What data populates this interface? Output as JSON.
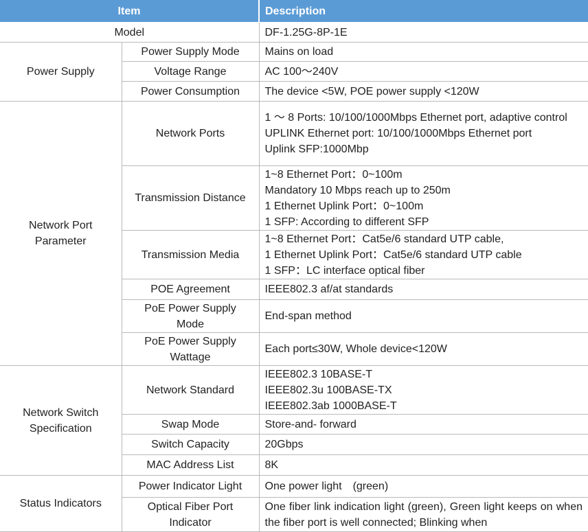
{
  "header": {
    "item": "Item",
    "description": "Description"
  },
  "model": {
    "label": "Model",
    "value": "DF-1.25G-8P-1E"
  },
  "power_supply": {
    "category": "Power Supply",
    "mode": {
      "label": "Power Supply Mode",
      "value": "Mains on load"
    },
    "voltage": {
      "label": "Voltage Range",
      "value": "AC 100～240V"
    },
    "consumption": {
      "label": "Power Consumption",
      "value": "The device <5W, POE power supply <120W"
    }
  },
  "network_port": {
    "category_line1": "Network Port",
    "category_line2": "Parameter",
    "ports": {
      "label": "Network Ports",
      "lines": [
        "1 ～ 8 Ports: 10/100/1000Mbps Ethernet port, adaptive control",
        "UPLINK Ethernet port: 10/100/1000Mbps Ethernet port",
        "Uplink SFP:1000Mbp"
      ]
    },
    "distance": {
      "label": "Transmission Distance",
      "lines": [
        "1~8 Ethernet Port：0~100m",
        "Mandatory 10 Mbps reach up to 250m",
        "1 Ethernet Uplink Port：0~100m",
        "1 SFP: According to different SFP"
      ]
    },
    "media": {
      "label": "Transmission Media",
      "lines": [
        "1~8 Ethernet Port：Cat5e/6 standard UTP cable,",
        "1 Ethernet Uplink Port：Cat5e/6 standard UTP cable",
        "1 SFP：LC interface optical fiber"
      ]
    },
    "poe_agreement": {
      "label": "POE Agreement",
      "value": "IEEE802.3 af/at standards"
    },
    "poe_mode": {
      "label_line1": "PoE Power Supply",
      "label_line2": "Mode",
      "value": "End-span method"
    },
    "poe_wattage": {
      "label_line1": "PoE Power Supply",
      "label_line2": "Wattage",
      "value": "Each port≤30W, Whole device<120W"
    }
  },
  "switch_spec": {
    "category_line1": "Network Switch",
    "category_line2": "Specification",
    "standard": {
      "label": "Network Standard",
      "lines": [
        "IEEE802.3 10BASE-T",
        "IEEE802.3u 100BASE-TX",
        "IEEE802.3ab 1000BASE-T"
      ]
    },
    "swap_mode": {
      "label": "Swap Mode",
      "value": "Store-and- forward"
    },
    "capacity": {
      "label": "Switch Capacity",
      "value": "20Gbps"
    },
    "mac": {
      "label": "MAC Address List",
      "value": "8K"
    }
  },
  "status": {
    "category": "Status Indicators",
    "power_light": {
      "label": "Power Indicator Light",
      "value": "One power light　(green)"
    },
    "fiber_light": {
      "label_line1": "Optical Fiber Port",
      "label_line2": "Indicator",
      "value": "One fiber link indication light (green), Green light keeps on when the fiber port is well connected; Blinking when"
    }
  }
}
